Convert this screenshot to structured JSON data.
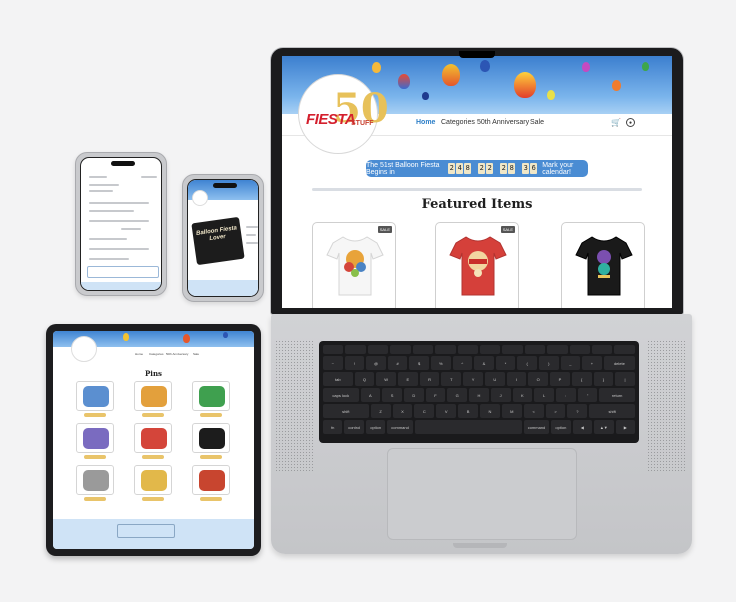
{
  "site": {
    "logo": {
      "big_number": "50",
      "wordmark": "FIESTA",
      "tag": "STUFF"
    },
    "nav": [
      "Home",
      "Categories",
      "50th Anniversary",
      "Sale"
    ],
    "nav_active": "Home",
    "countdown": {
      "prefix": "The 51st Balloon Fiesta Begins in",
      "groups": [
        "2 4 8",
        "2 2",
        "2 8",
        "3 6"
      ],
      "suffix": "Mark your calendar!"
    },
    "featured_title": "Featured Items",
    "products": [
      {
        "badge": "SALE",
        "shirt_color": "#f6f6f6"
      },
      {
        "badge": "SALE",
        "shirt_color": "#d5403a"
      },
      {
        "badge": "",
        "shirt_color": "#1a1a1a"
      }
    ]
  },
  "keyboard": {
    "row2": [
      "~",
      "!",
      "@",
      "#",
      "$",
      "%",
      "^",
      "&",
      "*",
      "(",
      ")",
      "_",
      "+",
      "delete"
    ],
    "row3": [
      "tab",
      "Q",
      "W",
      "E",
      "R",
      "T",
      "Y",
      "U",
      "I",
      "O",
      "P",
      "{",
      "}",
      "|"
    ],
    "row4": [
      "caps lock",
      "A",
      "S",
      "D",
      "F",
      "G",
      "H",
      "J",
      "K",
      "L",
      ":",
      "\"",
      "return"
    ],
    "row5": [
      "shift",
      "Z",
      "X",
      "C",
      "V",
      "B",
      "N",
      "M",
      "<",
      ">",
      "?",
      "shift"
    ],
    "row6": [
      "fn",
      "control",
      "option",
      "command",
      "",
      "command",
      "option",
      "◀",
      "▲▼",
      "▶"
    ]
  },
  "tablet": {
    "title": "Pins",
    "nav": [
      "Home",
      "Categories",
      "50th Anniversary",
      "Sale"
    ]
  },
  "phone_small": {
    "overlay_text": "Balloon Fiesta Lover"
  },
  "colors": {
    "accent_blue": "#4a8cd3",
    "brand_red": "#d41f2d",
    "gold": "#e7c15a",
    "pin_button": "#e9c46a"
  }
}
